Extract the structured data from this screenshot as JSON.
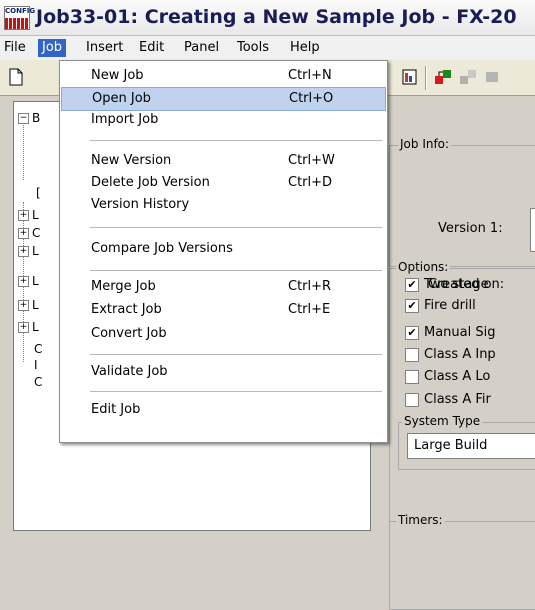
{
  "window": {
    "title": "Job33-01: Creating a New Sample Job - FX-20",
    "app_icon_text": "CONFIG"
  },
  "menubar": {
    "items": [
      "File",
      "Job",
      "Insert",
      "Edit",
      "Panel",
      "Tools",
      "Help"
    ],
    "active": "Job"
  },
  "job_menu": {
    "items": [
      {
        "label": "New Job",
        "shortcut": "Ctrl+N"
      },
      {
        "label": "Open Job",
        "shortcut": "Ctrl+O"
      },
      {
        "label": "Import Job",
        "shortcut": ""
      },
      {
        "label": "New Version",
        "shortcut": "Ctrl+W"
      },
      {
        "label": "Delete Job Version",
        "shortcut": "Ctrl+D"
      },
      {
        "label": "Version History",
        "shortcut": ""
      },
      {
        "label": "Compare Job Versions",
        "shortcut": ""
      },
      {
        "label": "Merge Job",
        "shortcut": "Ctrl+R"
      },
      {
        "label": "Extract Job",
        "shortcut": "Ctrl+E"
      },
      {
        "label": "Convert Job",
        "shortcut": ""
      },
      {
        "label": "Validate Job",
        "shortcut": ""
      },
      {
        "label": "Edit Job",
        "shortcut": ""
      }
    ],
    "highlighted": "Open Job"
  },
  "tree": {
    "rows": [
      {
        "expander": "−",
        "label": "B"
      },
      {
        "expander": "",
        "label": "["
      },
      {
        "expander": "+",
        "label": "L"
      },
      {
        "expander": "+",
        "label": "C"
      },
      {
        "expander": "+",
        "label": "L"
      },
      {
        "expander": "+",
        "label": "L"
      },
      {
        "expander": "+",
        "label": "L"
      },
      {
        "expander": "+",
        "label": "L"
      },
      {
        "expander": "",
        "label": "C"
      },
      {
        "expander": "",
        "label": "I"
      },
      {
        "expander": "",
        "label": "C"
      }
    ]
  },
  "job_info": {
    "group_title": "Job Info:",
    "version_label": "Version 1:",
    "created_label": "Created on:"
  },
  "options": {
    "group_title": "Options:",
    "items": [
      {
        "label": "Two stage",
        "checked": true
      },
      {
        "label": "Fire drill",
        "checked": true
      },
      {
        "label": "Manual Sig",
        "checked": true
      },
      {
        "label": "Class A Inp",
        "checked": false
      },
      {
        "label": "Class A Lo",
        "checked": false
      },
      {
        "label": "Class A Fir",
        "checked": false
      }
    ],
    "system_type": {
      "group_title": "System Type",
      "value": "Large Build"
    }
  },
  "timers": {
    "group_title": "Timers:"
  },
  "colors": {
    "menu_highlight": "#c1d2ee",
    "active_menu": "#3264c8",
    "title_text": "#1b1b56"
  }
}
